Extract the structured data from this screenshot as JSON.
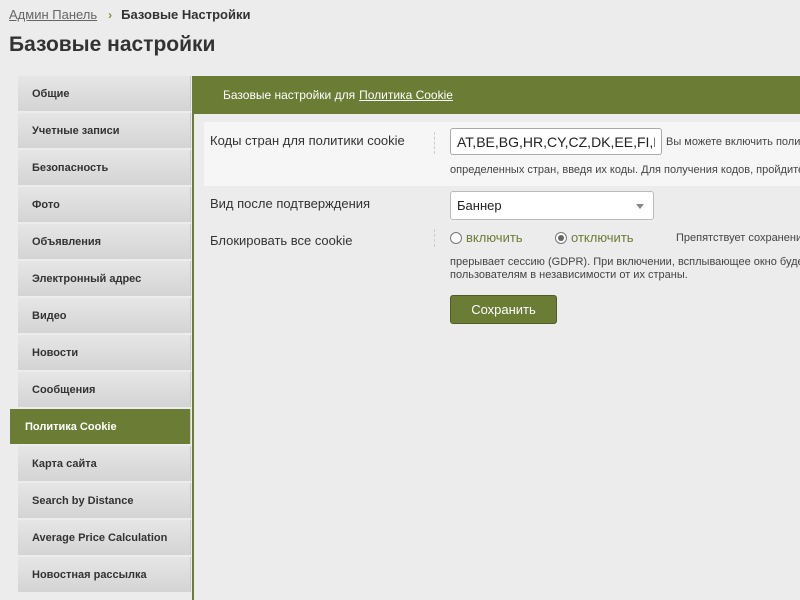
{
  "breadcrumb": {
    "link": "Админ Панель",
    "separator": "›",
    "current": "Базовые Настройки"
  },
  "page_title": "Базовые настройки",
  "sidebar": {
    "items": [
      {
        "label": "Общие"
      },
      {
        "label": "Учетные записи"
      },
      {
        "label": "Безопасность"
      },
      {
        "label": "Фото"
      },
      {
        "label": "Объявления"
      },
      {
        "label": "Электронный адрес"
      },
      {
        "label": "Видео"
      },
      {
        "label": "Новости"
      },
      {
        "label": "Сообщения"
      },
      {
        "label": "Политика Cookie",
        "active": true
      },
      {
        "label": "Карта сайта"
      },
      {
        "label": "Search by Distance"
      },
      {
        "label": "Average Price Calculation"
      },
      {
        "label": "Новостная рассылка"
      }
    ]
  },
  "header": {
    "prefix": "Базовые настройки для",
    "link": "Политика Cookie"
  },
  "form": {
    "country_codes": {
      "label": "Коды стран для политики cookie",
      "value": "AT,BE,BG,HR,CY,CZ,DK,EE,FI,FR",
      "hint_line1": "Вы можете включить полит",
      "hint_line2": "определенных стран, введя их коды. Для получения кодов, пройдите"
    },
    "view_after_confirm": {
      "label": "Вид после подтверждения",
      "selected": "Баннер"
    },
    "block_all": {
      "label": "Блокировать все cookie",
      "option_on": "включить",
      "option_off": "отключить",
      "hint_line1": "Препятствует сохранени",
      "hint_line2": "прерывает сессию (GDPR). При включении, всплывающее окно буде",
      "hint_line3": "пользователям в независимости от их страны."
    },
    "save_label": "Сохранить"
  },
  "colors": {
    "accent": "#6b7c35",
    "background": "#ececec"
  }
}
